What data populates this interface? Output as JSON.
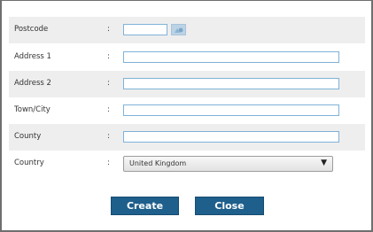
{
  "form": {
    "fields": [
      {
        "label": "Postcode",
        "colon": ":",
        "value": ""
      },
      {
        "label": "Address 1",
        "colon": ":",
        "value": ""
      },
      {
        "label": "Address 2",
        "colon": ":",
        "value": ""
      },
      {
        "label": "Town/City",
        "colon": ":",
        "value": ""
      },
      {
        "label": "County",
        "colon": ":",
        "value": ""
      },
      {
        "label": "Country",
        "colon": ":",
        "value": "United Kingdom"
      }
    ],
    "lookup_icon": "postcode-lookup-icon",
    "dropdown_arrow": "▼"
  },
  "buttons": {
    "create_label": "Create",
    "close_label": "Close"
  },
  "colors": {
    "button_bg": "#1e5f8c",
    "field_border": "#7fb2d8",
    "row_shade": "#eeeeee"
  }
}
